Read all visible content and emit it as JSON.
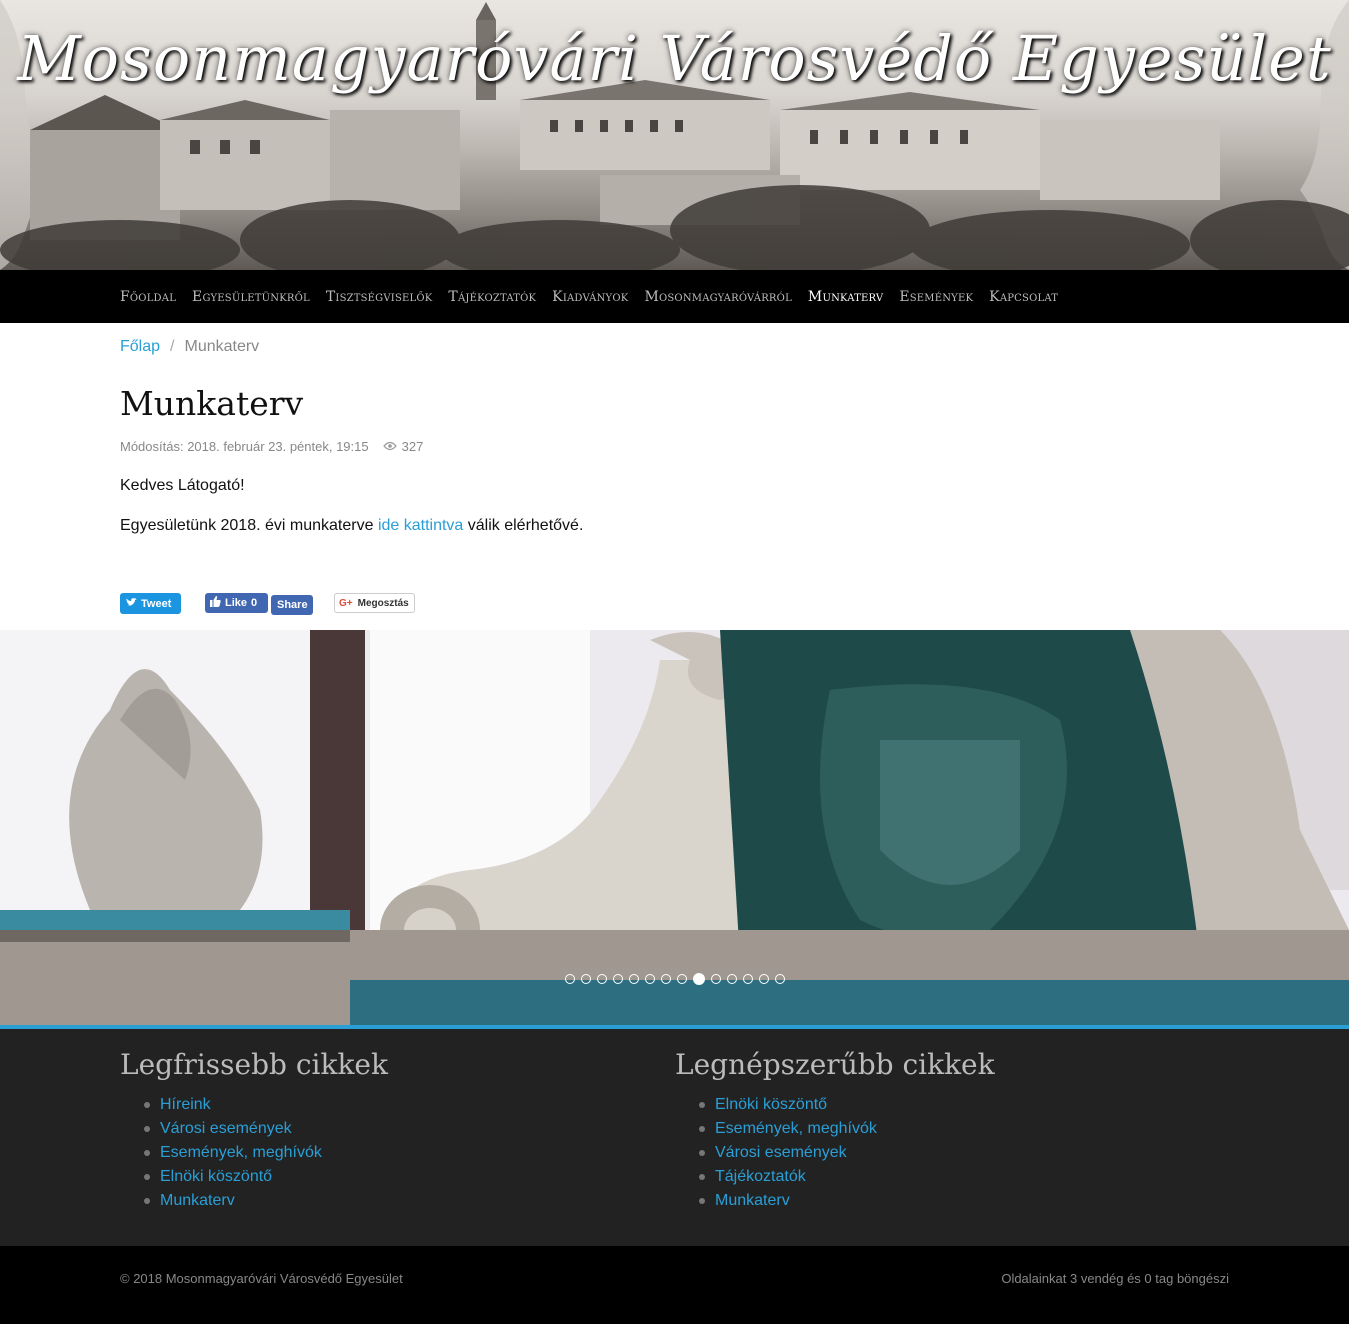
{
  "header": {
    "site_title": "Mosonmagyaróvári Városvédő Egyesület"
  },
  "nav": {
    "items": [
      {
        "label": "Főoldal"
      },
      {
        "label": "Egyesületünkről"
      },
      {
        "label": "Tisztségviselők"
      },
      {
        "label": "Tájékoztatók"
      },
      {
        "label": "Kiadványok"
      },
      {
        "label": "Mosonmagyaróvárról"
      },
      {
        "label": "Munkaterv"
      },
      {
        "label": "Események"
      },
      {
        "label": "Kapcsolat"
      }
    ],
    "active": "Munkaterv"
  },
  "breadcrumb": {
    "home": "Főlap",
    "separator": "/",
    "current": "Munkaterv"
  },
  "article": {
    "title": "Munkaterv",
    "modified": "Módosítás: 2018. február 23. péntek, 19:15",
    "views": "327",
    "greeting": "Kedves Látogató!",
    "text_before": "Egyesületünk 2018. évi munkaterve ",
    "link_text": "ide kattintva",
    "text_after": " válik elérhetővé."
  },
  "share": {
    "tweet": "Tweet",
    "fb_like": "Like",
    "fb_like_count": "0",
    "fb_share": "Share",
    "gplus": "Megosztás",
    "gplus_icon": "G+"
  },
  "slideshow": {
    "slide_count": 14,
    "active_index": 8
  },
  "latest": {
    "title": "Legfrissebb cikkek",
    "items": [
      "Híreink",
      "Városi események",
      "Események, meghívók",
      "Elnöki köszöntő",
      "Munkaterv"
    ]
  },
  "popular": {
    "title": "Legnépszerűbb cikkek",
    "items": [
      "Elnöki köszöntő",
      "Események, meghívók",
      "Városi események",
      "Tájékoztatók",
      "Munkaterv"
    ]
  },
  "footer": {
    "copyright": "© 2018 Mosonmagyaróvári Városvédő Egyesület",
    "visitors": "Oldalainkat 3 vendég és 0 tag böngészi"
  },
  "colors": {
    "accent": "#2a9fd6",
    "nav_bg": "#000000",
    "footer_bg": "#222222"
  }
}
